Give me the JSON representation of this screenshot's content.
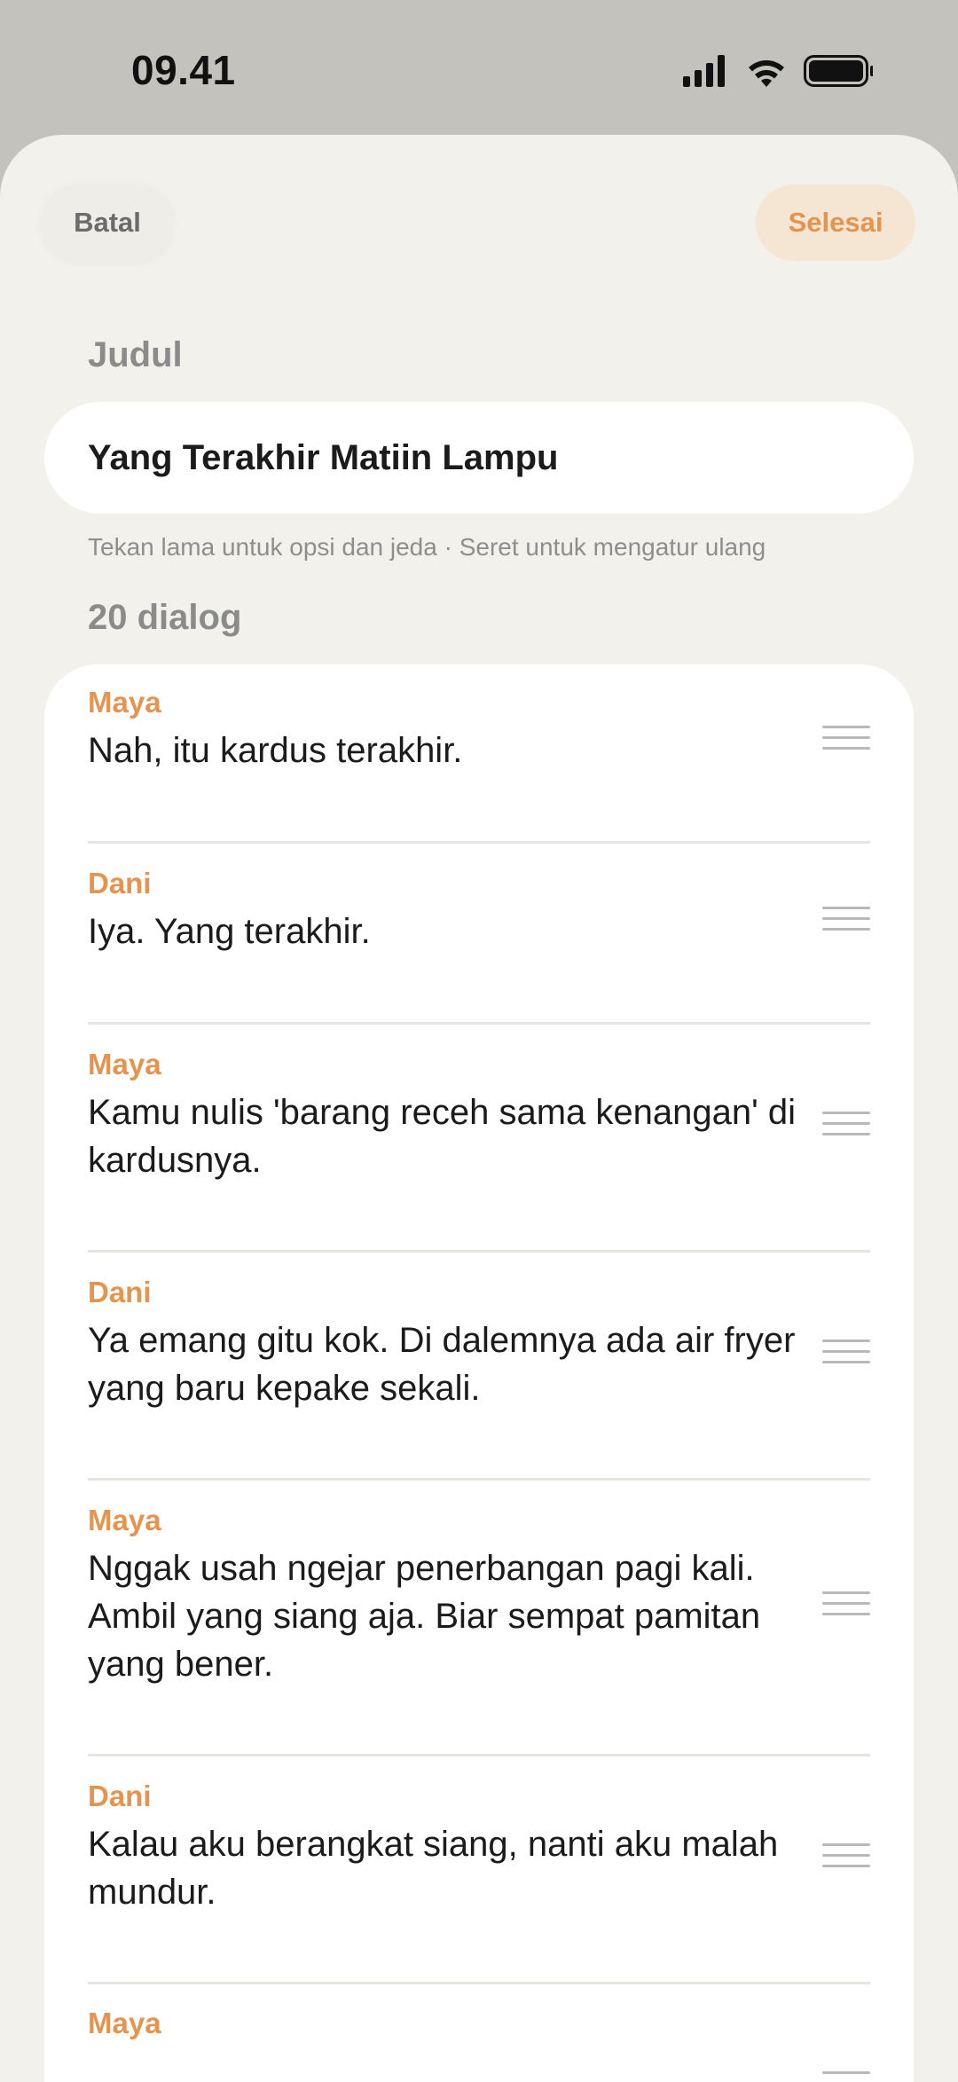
{
  "status_bar": {
    "time": "09.41"
  },
  "header": {
    "cancel_label": "Batal",
    "done_label": "Selesai"
  },
  "title_section": {
    "label": "Judul",
    "value": "Yang Terakhir Matiin Lampu"
  },
  "hint": "Tekan lama untuk opsi dan jeda · Seret untuk mengatur ulang",
  "dialog_count": "20 dialog",
  "colors": {
    "accent": "#e4944f",
    "background": "#f3f1ec",
    "card": "#ffffff"
  },
  "dialogs": [
    {
      "speaker": "Maya",
      "text": "Nah, itu kardus terakhir."
    },
    {
      "speaker": "Dani",
      "text": "Iya. Yang terakhir."
    },
    {
      "speaker": "Maya",
      "text": "Kamu nulis 'barang receh sama kenangan' di kardusnya."
    },
    {
      "speaker": "Dani",
      "text": "Ya emang gitu kok. Di dalemnya ada air fryer yang baru kepake sekali."
    },
    {
      "speaker": "Maya",
      "text": "Nggak usah ngejar penerbangan pagi kali. Ambil yang siang aja. Biar sempat pamitan yang bener."
    },
    {
      "speaker": "Dani",
      "text": "Kalau aku berangkat siang, nanti aku malah mundur."
    },
    {
      "speaker": "Maya",
      "text": ""
    }
  ],
  "icons": {
    "signal": "cellular-signal-icon",
    "wifi": "wifi-icon",
    "battery": "battery-icon",
    "drag": "drag-handle-icon"
  }
}
